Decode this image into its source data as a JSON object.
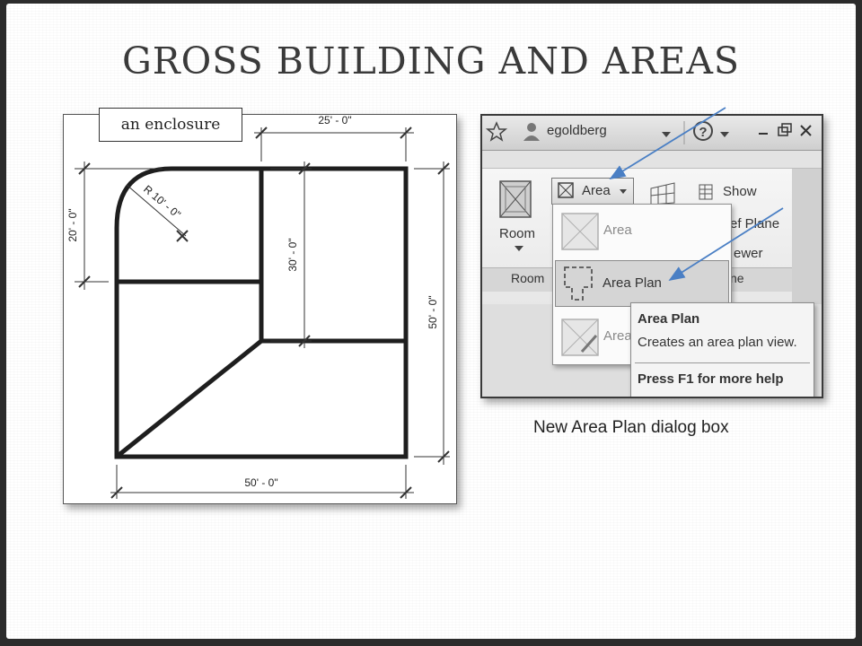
{
  "slide": {
    "title": "GROSS BUILDING AND AREAS",
    "callout": "an enclosure",
    "caption": "New Area Plan dialog box"
  },
  "plan": {
    "dim_top": "25' - 0\"",
    "dim_left": "20' - 0\"",
    "dim_radius": "R 10' - 0\"",
    "dim_middle": "30' - 0\"",
    "dim_right": "50' - 0\"",
    "dim_bottom": "50' - 0\""
  },
  "revit_ui": {
    "username": "egoldberg",
    "ribbon": {
      "room_button": "Room",
      "area_button": "Area",
      "show_button": "Show",
      "ref_plane_partial": "ef Plane",
      "viewer_partial": "ewer",
      "panel_room_partial": "Room",
      "panel_plane_partial": "ne"
    },
    "dropdown": {
      "items": [
        {
          "label": "Area",
          "state": "disabled"
        },
        {
          "label": "Area Plan",
          "state": "highlighted"
        },
        {
          "label": "Area",
          "state": "partially hidden"
        }
      ]
    },
    "tooltip": {
      "title": "Area Plan",
      "description": "Creates an area plan view.",
      "help": "Press F1 for more help"
    }
  },
  "colors": {
    "arrow": "#4a7fc4",
    "wall": "#1e1e1e",
    "frame_border": "#3a3a3a"
  }
}
